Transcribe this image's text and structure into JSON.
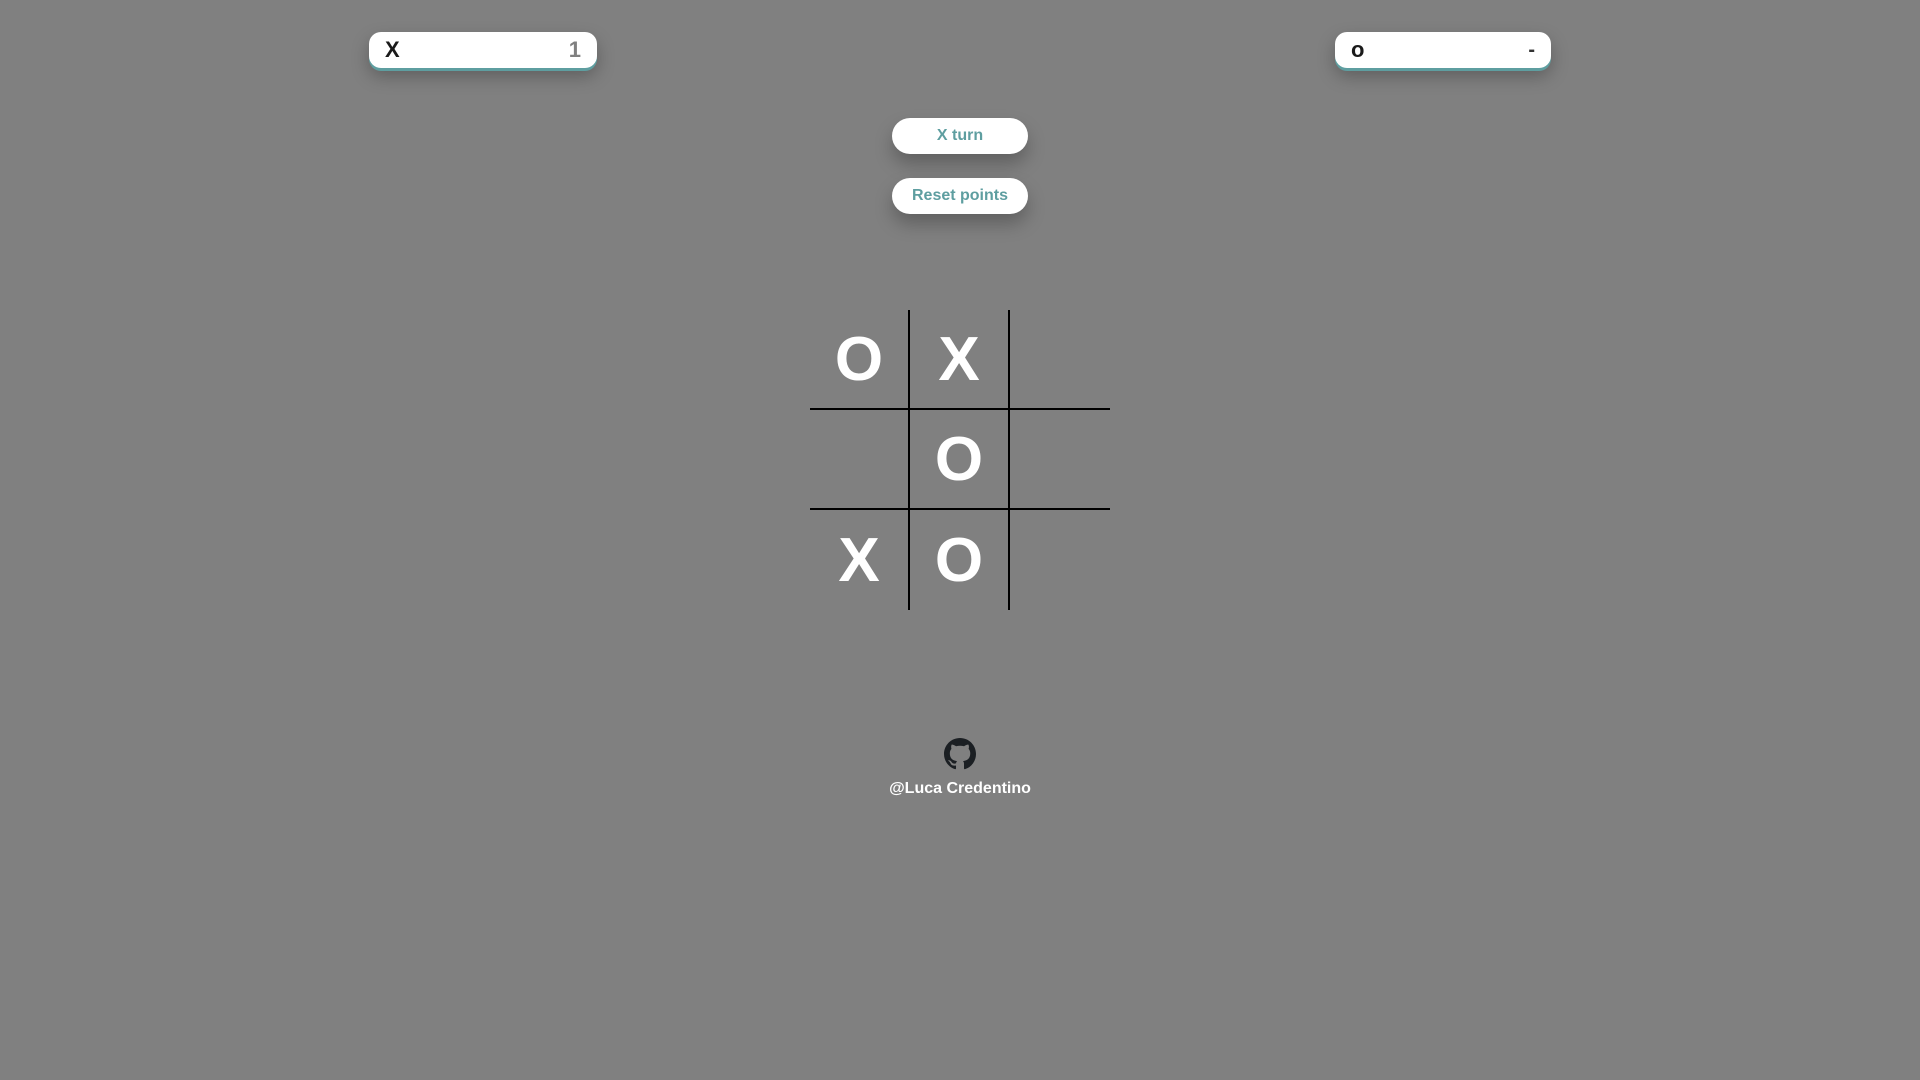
{
  "scoreboard": {
    "player_x": {
      "label": "X",
      "score": "1"
    },
    "player_o": {
      "label": "o",
      "score": "-"
    }
  },
  "controls": {
    "turn_label": "X turn",
    "reset_label": "Reset points"
  },
  "board": {
    "cells": [
      "O",
      "X",
      "",
      "",
      "O",
      "",
      "X",
      "O",
      ""
    ]
  },
  "footer": {
    "icon": "github-icon",
    "author": "@Luca Credentino"
  },
  "colors": {
    "background": "#808080",
    "accent": "#5e9ea0",
    "mark": "#ffffff"
  }
}
